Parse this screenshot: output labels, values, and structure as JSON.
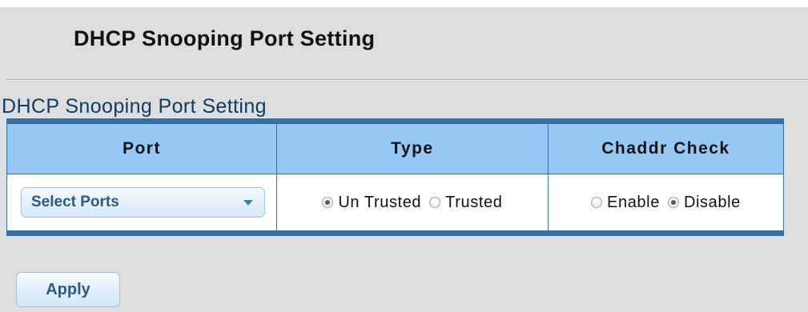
{
  "page": {
    "title": "DHCP Snooping Port Setting"
  },
  "section": {
    "heading": "DHCP Snooping Port Setting"
  },
  "table": {
    "headers": {
      "port": "Port",
      "type": "Type",
      "chaddr_check": "Chaddr Check"
    },
    "row": {
      "port_select": {
        "label": "Select Ports"
      },
      "type": {
        "options": [
          {
            "label": "Un Trusted",
            "checked": true
          },
          {
            "label": "Trusted",
            "checked": false
          }
        ]
      },
      "chaddr_check": {
        "options": [
          {
            "label": "Enable",
            "checked": false
          },
          {
            "label": "Disable",
            "checked": true
          }
        ]
      }
    }
  },
  "actions": {
    "apply_label": "Apply"
  },
  "colors": {
    "panel_bg": "#dedede",
    "table_border": "#37709e",
    "header_bg": "#97c8f5",
    "heading_text": "#0d3d66",
    "button_text": "#2b5b85"
  }
}
